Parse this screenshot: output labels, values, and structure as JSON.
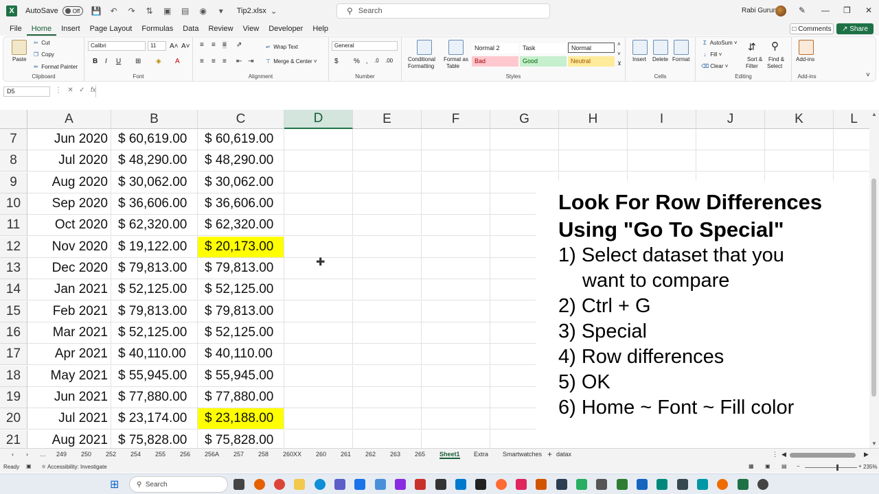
{
  "titlebar": {
    "autosave_label": "AutoSave",
    "autosave_state": "Off",
    "filename": "Tip2.xlsx",
    "search_placeholder": "Search",
    "user_name": "Rabi Gurung"
  },
  "tabs": [
    "File",
    "Home",
    "Insert",
    "Page Layout",
    "Formulas",
    "Data",
    "Review",
    "View",
    "Developer",
    "Help"
  ],
  "active_tab": "Home",
  "comments_label": "Comments",
  "share_label": "Share",
  "ribbon": {
    "clipboard": {
      "label": "Clipboard",
      "paste": "Paste",
      "cut": "Cut",
      "copy": "Copy",
      "format_painter": "Format Painter"
    },
    "font": {
      "label": "Font",
      "name": "Calibri",
      "size": "11"
    },
    "alignment": {
      "label": "Alignment",
      "wrap_text": "Wrap Text",
      "merge_center": "Merge & Center"
    },
    "number": {
      "label": "Number",
      "format": "General"
    },
    "styles": {
      "label": "Styles",
      "conditional_formatting_1": "Conditional",
      "conditional_formatting_2": "Formatting",
      "format_as_table_1": "Format as",
      "format_as_table_2": "Table",
      "cells": [
        {
          "name": "Normal 2",
          "bg": "#ffffff",
          "fg": "#222222"
        },
        {
          "name": "Task",
          "bg": "#ffffff",
          "fg": "#222222"
        },
        {
          "name": "Normal",
          "bg": "#ffffff",
          "fg": "#222222"
        },
        {
          "name": "Bad",
          "bg": "#ffc7ce",
          "fg": "#9c0006"
        },
        {
          "name": "Good",
          "bg": "#c6efce",
          "fg": "#006100"
        },
        {
          "name": "Neutral",
          "bg": "#ffeb9c",
          "fg": "#9c5700"
        }
      ]
    },
    "cells": {
      "label": "Cells",
      "insert": "Insert",
      "delete": "Delete",
      "format": "Format"
    },
    "editing": {
      "label": "Editing",
      "autosum": "AutoSum",
      "fill": "Fill",
      "clear": "Clear",
      "sort_filter_1": "Sort &",
      "sort_filter_2": "Filter",
      "find_select_1": "Find &",
      "find_select_2": "Select"
    },
    "addins": {
      "label": "Add-ins",
      "addins": "Add-ins"
    }
  },
  "formula_bar": {
    "name_box": "D5",
    "fx": "fx",
    "content": ""
  },
  "columns": [
    "A",
    "B",
    "C",
    "D",
    "E",
    "F",
    "G",
    "H",
    "I",
    "J",
    "K",
    "L"
  ],
  "selected_column": "D",
  "rows": [
    {
      "num": "7",
      "a": "Jun 2020",
      "b": "$ 60,619.00",
      "c": "$ 60,619.00",
      "hl": false
    },
    {
      "num": "8",
      "a": "Jul 2020",
      "b": "$ 48,290.00",
      "c": "$ 48,290.00",
      "hl": false
    },
    {
      "num": "9",
      "a": "Aug 2020",
      "b": "$ 30,062.00",
      "c": "$ 30,062.00",
      "hl": false
    },
    {
      "num": "10",
      "a": "Sep 2020",
      "b": "$ 36,606.00",
      "c": "$ 36,606.00",
      "hl": false
    },
    {
      "num": "11",
      "a": "Oct 2020",
      "b": "$ 62,320.00",
      "c": "$ 62,320.00",
      "hl": false
    },
    {
      "num": "12",
      "a": "Nov 2020",
      "b": "$ 19,122.00",
      "c": "$ 20,173.00",
      "hl": true
    },
    {
      "num": "13",
      "a": "Dec 2020",
      "b": "$ 79,813.00",
      "c": "$ 79,813.00",
      "hl": false
    },
    {
      "num": "14",
      "a": "Jan 2021",
      "b": "$ 52,125.00",
      "c": "$ 52,125.00",
      "hl": false
    },
    {
      "num": "15",
      "a": "Feb 2021",
      "b": "$ 79,813.00",
      "c": "$ 79,813.00",
      "hl": false
    },
    {
      "num": "16",
      "a": "Mar 2021",
      "b": "$ 52,125.00",
      "c": "$ 52,125.00",
      "hl": false
    },
    {
      "num": "17",
      "a": "Apr 2021",
      "b": "$ 40,110.00",
      "c": "$ 40,110.00",
      "hl": false
    },
    {
      "num": "18",
      "a": "May 2021",
      "b": "$ 55,945.00",
      "c": "$ 55,945.00",
      "hl": false
    },
    {
      "num": "19",
      "a": "Jun 2021",
      "b": "$ 77,880.00",
      "c": "$ 77,880.00",
      "hl": false
    },
    {
      "num": "20",
      "a": "Jul 2021",
      "b": "$ 23,174.00",
      "c": "$ 23,188.00",
      "hl": true
    },
    {
      "num": "21",
      "a": "Aug 2021",
      "b": "$ 75,828.00",
      "c": "$ 75,828.00",
      "hl": false
    }
  ],
  "highlight_color": "#ffff00",
  "instructions": {
    "title_line1": "Look For Row Differences",
    "title_line2": "Using \"Go To Special\"",
    "steps": [
      "1) Select dataset that you",
      "want to compare",
      "2) Ctrl + G",
      "3) Special",
      "4) Row differences",
      "5) OK",
      "6) Home ~ Font ~ Fill color"
    ]
  },
  "sheet_tabs": [
    "249",
    "250",
    "252",
    "254",
    "255",
    "256",
    "256A",
    "257",
    "258",
    "260XX",
    "260",
    "261",
    "262",
    "263",
    "265",
    "Sheet1",
    "Extra",
    "Smartwatches",
    "datax"
  ],
  "active_sheet": "Sheet1",
  "status": {
    "ready": "Ready",
    "accessibility": "Accessibility: Investigate",
    "zoom": "235%"
  },
  "taskbar": {
    "search_placeholder": "Search"
  }
}
